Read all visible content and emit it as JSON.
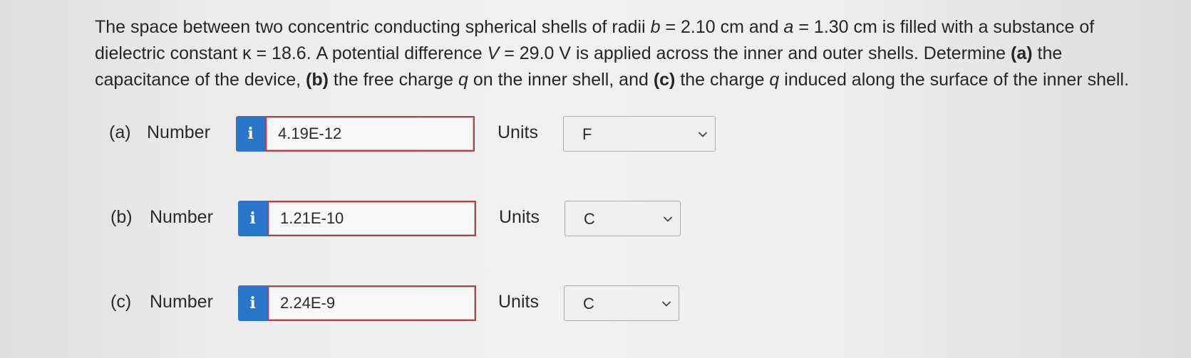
{
  "question": {
    "p1": "The space between two concentric conducting spherical shells of radii ",
    "var_b": "b",
    "p2": " = 2.10 cm and ",
    "var_a": "a",
    "p3": " = 1.30 cm is filled with a substance of dielectric constant κ = 18.6. A potential difference ",
    "var_V": "V",
    "p4": " = 29.0 V is applied across the inner and outer shells. Determine ",
    "a_tag": "(a)",
    "p5": " the capacitance of the device, ",
    "b_tag": "(b)",
    "p6": " the free charge ",
    "var_q1": "q",
    "p7": " on the inner shell, and ",
    "c_tag": "(c)",
    "p8": " the charge ",
    "var_q2": "q",
    "p9": " induced along the surface of the inner shell."
  },
  "number_label": "Number",
  "units_label": "Units",
  "info_icon_glyph": "i",
  "parts": [
    {
      "label": "(a)",
      "value": "4.19E-12",
      "unit": "F"
    },
    {
      "label": "(b)",
      "value": "1.21E-10",
      "unit": "C"
    },
    {
      "label": "(c)",
      "value": "2.24E-9",
      "unit": "C"
    }
  ],
  "colors": {
    "info_button": "#2a74c9",
    "answer_border": "#a8464b"
  },
  "icons": {
    "info": "info-icon",
    "dropdown": "chevron-down-icon"
  }
}
